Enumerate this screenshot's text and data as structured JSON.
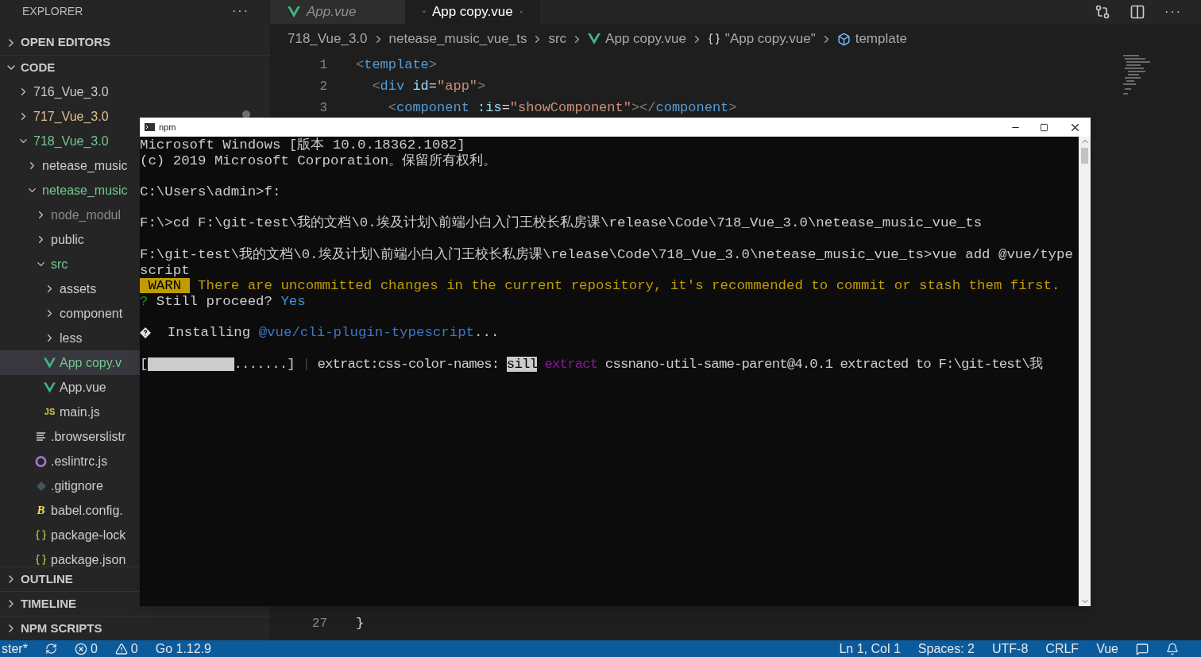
{
  "sidebar": {
    "title": "EXPLORER",
    "more": "···",
    "sections_top": [
      {
        "label": "OPEN EDITORS",
        "expanded": false
      },
      {
        "label": "CODE",
        "expanded": true
      }
    ],
    "tree": [
      {
        "label": "716_Vue_3.0",
        "kind": "folder",
        "color": "#cccccc",
        "expanded": false,
        "selected": false
      },
      {
        "label": "717_Vue_3.0",
        "kind": "folder",
        "color": "#e2c08d",
        "expanded": false,
        "selected": false,
        "dot": true
      },
      {
        "label": "718_Vue_3.0",
        "kind": "folder",
        "color": "#73c991",
        "expanded": true,
        "selected": false,
        "children": [
          {
            "label": "netease_music",
            "kind": "folder",
            "color": "#cccccc",
            "expanded": false,
            "selected": false
          },
          {
            "label": "netease_music",
            "kind": "folder",
            "color": "#73c991",
            "expanded": true,
            "selected": false,
            "children": [
              {
                "label": "node_modul",
                "kind": "folder",
                "color": "#8b8b8b",
                "expanded": false,
                "selected": false
              },
              {
                "label": "public",
                "kind": "folder",
                "color": "#cccccc",
                "expanded": false,
                "selected": false
              },
              {
                "label": "src",
                "kind": "folder",
                "color": "#73c991",
                "expanded": true,
                "selected": false,
                "children": [
                  {
                    "label": "assets",
                    "kind": "folder",
                    "color": "#cccccc",
                    "expanded": false,
                    "selected": false
                  },
                  {
                    "label": "component",
                    "kind": "folder",
                    "color": "#cccccc",
                    "expanded": false,
                    "selected": false
                  },
                  {
                    "label": "less",
                    "kind": "folder",
                    "color": "#cccccc",
                    "expanded": false,
                    "selected": false
                  },
                  {
                    "label": "App copy.v",
                    "kind": "vue",
                    "color": "#73c991",
                    "selected": true
                  },
                  {
                    "label": "App.vue",
                    "kind": "vue",
                    "color": "#cccccc",
                    "selected": false
                  },
                  {
                    "label": "main.js",
                    "kind": "js",
                    "glyph": "JS",
                    "color": "#cccccc",
                    "selected": false
                  }
                ]
              },
              {
                "label": ".browserslistr",
                "kind": "lines",
                "color": "#cccccc",
                "selected": false
              },
              {
                "label": ".eslintrc.js",
                "kind": "eslint",
                "color": "#cccccc",
                "selected": false
              },
              {
                "label": ".gitignore",
                "kind": "git",
                "color": "#cccccc",
                "selected": false
              },
              {
                "label": "babel.config.",
                "kind": "babel",
                "glyph": "B",
                "color": "#cccccc",
                "selected": false
              },
              {
                "label": "package-lock",
                "kind": "json",
                "color": "#cccccc",
                "selected": false
              },
              {
                "label": "package.json",
                "kind": "json",
                "color": "#cccccc",
                "selected": false
              }
            ]
          }
        ]
      }
    ],
    "sections_bottom": [
      {
        "label": "OUTLINE",
        "expanded": false
      },
      {
        "label": "TIMELINE",
        "expanded": false
      },
      {
        "label": "NPM SCRIPTS",
        "expanded": false
      }
    ]
  },
  "tabs": [
    {
      "label": "App.vue",
      "selected": false,
      "preview": true
    },
    {
      "label": "App copy.vue",
      "selected": true,
      "preview": false
    }
  ],
  "tab_actions_more": "···",
  "breadcrumbs": [
    {
      "kind": "text",
      "text": "718_Vue_3.0"
    },
    {
      "kind": "text",
      "text": "netease_music_vue_ts"
    },
    {
      "kind": "text",
      "text": "src"
    },
    {
      "kind": "vue",
      "text": "App copy.vue"
    },
    {
      "kind": "braces",
      "text": "\"App copy.vue\""
    },
    {
      "kind": "component",
      "text": "template"
    }
  ],
  "code_top": [
    {
      "number": "1",
      "segments": [
        {
          "text": "<",
          "color": "#808080"
        },
        {
          "text": "template",
          "color": "#569cd6"
        },
        {
          "text": ">",
          "color": "#808080"
        }
      ]
    },
    {
      "number": "2",
      "segments": [
        {
          "text": "  <",
          "color": "#808080"
        },
        {
          "text": "div",
          "color": "#569cd6"
        },
        {
          "text": " id",
          "color": "#9cdcfe"
        },
        {
          "text": "=",
          "color": "#d4d4d4"
        },
        {
          "text": "\"app\"",
          "color": "#ce9178"
        },
        {
          "text": ">",
          "color": "#808080"
        }
      ]
    },
    {
      "number": "3",
      "segments": [
        {
          "text": "    <",
          "color": "#808080"
        },
        {
          "text": "component",
          "color": "#569cd6"
        },
        {
          "text": " :is",
          "color": "#9cdcfe"
        },
        {
          "text": "=",
          "color": "#d4d4d4"
        },
        {
          "text": "\"showComponent\"",
          "color": "#ce9178"
        },
        {
          "text": "></",
          "color": "#808080"
        },
        {
          "text": "component",
          "color": "#569cd6"
        },
        {
          "text": ">",
          "color": "#808080"
        }
      ]
    }
  ],
  "code_bottom": [
    {
      "number": "27",
      "segments": [
        {
          "text": "}",
          "color": "#d4d4d4"
        }
      ]
    }
  ],
  "terminal": {
    "title": "npm",
    "lines": [
      {
        "kind": "text",
        "segments": [
          {
            "kind": "text",
            "text": "Microsoft Windows [版本 10.0.18362.1082]",
            "color": "#cccccc"
          }
        ]
      },
      {
        "kind": "text",
        "segments": [
          {
            "kind": "text",
            "text": "(c) 2019 Microsoft Corporation。保留所有权利。",
            "color": "#cccccc"
          }
        ]
      },
      {
        "kind": "blank"
      },
      {
        "kind": "text",
        "segments": [
          {
            "kind": "text",
            "text": "C:\\Users\\admin>f:",
            "color": "#cccccc"
          }
        ]
      },
      {
        "kind": "blank"
      },
      {
        "kind": "text",
        "segments": [
          {
            "kind": "text",
            "text": "F:\\>cd F:\\git-test\\我的文档\\0.埃及计划\\前端小白入门王校长私房课\\release\\Code\\718_Vue_3.0\\netease_music_vue_ts",
            "color": "#cccccc"
          }
        ]
      },
      {
        "kind": "blank"
      },
      {
        "kind": "text",
        "segments": [
          {
            "kind": "text",
            "text": "F:\\git-test\\我的文档\\0.埃及计划\\前端小白入门王校长私房课\\release\\Code\\718_Vue_3.0\\netease_music_vue_ts>vue add @vue/type",
            "color": "#cccccc"
          }
        ]
      },
      {
        "kind": "text",
        "segments": [
          {
            "kind": "text",
            "text": "script",
            "color": "#cccccc"
          }
        ]
      },
      {
        "kind": "text",
        "segments": [
          {
            "kind": "badge",
            "text": " WARN ",
            "color": "#c19c00"
          },
          {
            "kind": "text",
            "text": " There are uncommitted changes in the current repository, it's recommended to commit or stash them first.",
            "color": "#c19c00"
          }
        ]
      },
      {
        "kind": "text",
        "segments": [
          {
            "kind": "text",
            "text": "?",
            "color": "#13a10e"
          },
          {
            "kind": "text",
            "text": " Still proceed? ",
            "color": "#cccccc"
          },
          {
            "kind": "text",
            "text": "Yes",
            "color": "#3a96dd"
          }
        ]
      },
      {
        "kind": "blank"
      },
      {
        "kind": "text",
        "segments": [
          {
            "kind": "diamond"
          },
          {
            "kind": "text",
            "text": "  Installing ",
            "color": "#cccccc"
          },
          {
            "kind": "text",
            "text": "@vue/cli-plugin-typescript",
            "color": "#3b78c8"
          },
          {
            "kind": "text",
            "text": "...",
            "color": "#cccccc"
          }
        ]
      },
      {
        "kind": "blank"
      },
      {
        "kind": "progress",
        "segments": [
          {
            "kind": "text",
            "text": "["
          },
          {
            "kind": "bar",
            "color": "#cccccc"
          },
          {
            "kind": "text",
            "text": ".......] ",
            "color": "#cccccc"
          },
          {
            "kind": "text",
            "text": "| ",
            "color": "#444444"
          },
          {
            "kind": "text",
            "text": "extract:css-color-names: ",
            "color": "#cccccc"
          },
          {
            "kind": "badge",
            "text": "sill",
            "color": "#cccccc"
          },
          {
            "kind": "text",
            "text": " extract",
            "color": "#881798"
          },
          {
            "kind": "text",
            "text": " cssnano-util-same-parent@4.0.1 extracted to F:\\git-test\\我",
            "color": "#cccccc"
          }
        ]
      }
    ]
  },
  "status_bar": {
    "left": [
      {
        "kind": "text",
        "text": "ster*"
      },
      {
        "kind": "sync"
      },
      {
        "kind": "errors",
        "text": "0"
      },
      {
        "kind": "warnings",
        "text": "0"
      },
      {
        "kind": "text",
        "text": "Go 1.12.9"
      }
    ],
    "right": [
      {
        "kind": "text",
        "text": "Ln 1, Col 1"
      },
      {
        "kind": "text",
        "text": "Spaces: 2"
      },
      {
        "kind": "text",
        "text": "UTF-8"
      },
      {
        "kind": "text",
        "text": "CRLF"
      },
      {
        "kind": "text",
        "text": "Vue"
      },
      {
        "kind": "feedback"
      },
      {
        "kind": "bell"
      }
    ]
  }
}
